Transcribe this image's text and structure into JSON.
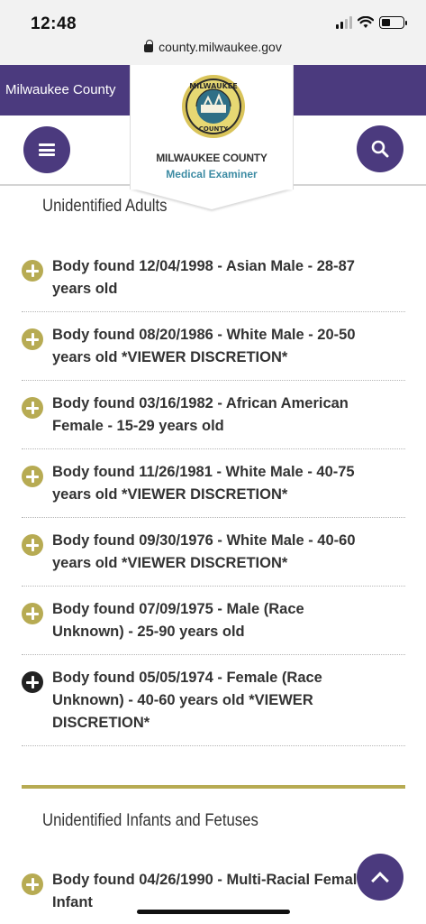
{
  "status": {
    "time": "12:48",
    "url": "county.milwaukee.gov"
  },
  "header": {
    "county_label": "Milwaukee County",
    "logo_title": "MILWAUKEE COUNTY",
    "logo_subtitle": "Medical Examiner",
    "seal_text_top": "MILWAUKEE",
    "seal_text_bottom": "COUNTY",
    "colors": {
      "brand_purple": "#4b3a7e",
      "gold": "#b7ab53",
      "teal": "#3c8ba3"
    }
  },
  "sections": [
    {
      "heading": "Unidentified Adults",
      "items": [
        {
          "text": "Body found 12/04/1998 - Asian Male - 28-87 years old",
          "expanded": false
        },
        {
          "text": "Body found 08/20/1986 - White Male - 20-50 years old *VIEWER DISCRETION*",
          "expanded": false
        },
        {
          "text": "Body found 03/16/1982 - African American Female - 15-29 years old",
          "expanded": false
        },
        {
          "text": "Body found 11/26/1981 - White Male - 40-75 years old *VIEWER DISCRETION*",
          "expanded": false
        },
        {
          "text": "Body found 09/30/1976 - White Male - 40-60 years old *VIEWER DISCRETION*",
          "expanded": false
        },
        {
          "text": "Body found 07/09/1975 - Male (Race Unknown) - 25-90 years old",
          "expanded": false
        },
        {
          "text": "Body found 05/05/1974 - Female (Race Unknown) - 40-60 years old *VIEWER DISCRETION*",
          "expanded": false,
          "active": true
        }
      ]
    },
    {
      "heading": "Unidentified Infants and Fetuses",
      "items": [
        {
          "text": "Body found 04/26/1990 - Multi-Racial Female Infant",
          "expanded": false
        }
      ]
    }
  ],
  "icons": {
    "menu": "hamburger-icon",
    "search": "search-icon",
    "back_to_top": "chevron-up-icon",
    "expand": "plus-circle-icon"
  }
}
